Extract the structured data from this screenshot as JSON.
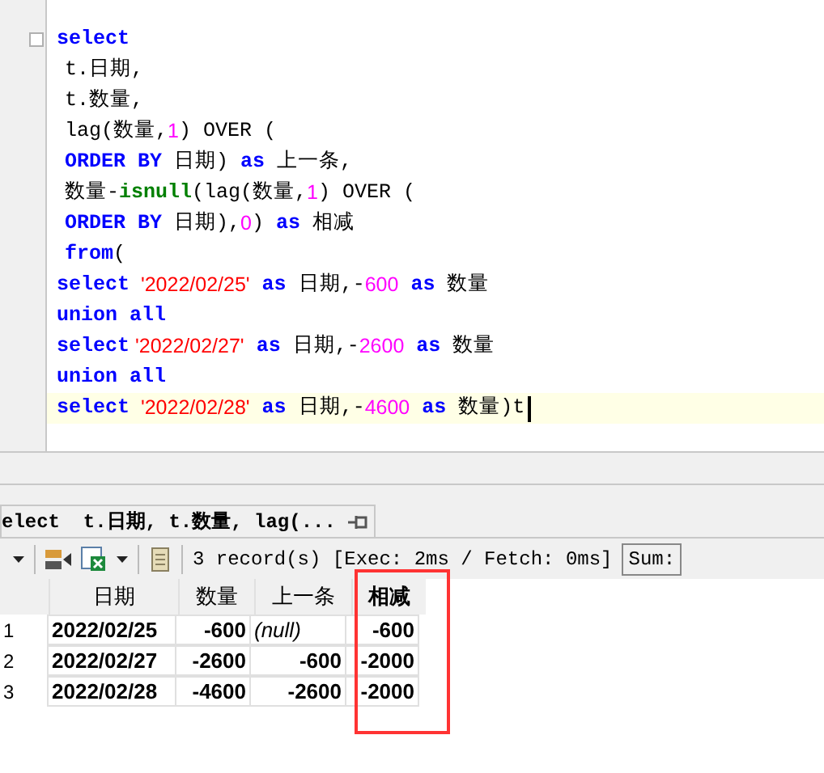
{
  "editor": {
    "lines": [
      {
        "indented": false,
        "current": false,
        "fold": true,
        "tokens": [
          {
            "kind": "keyword",
            "text": "select"
          }
        ]
      },
      {
        "indented": true,
        "current": false,
        "fold": false,
        "tokens": [
          {
            "kind": "plain",
            "text": "t.日期,"
          }
        ]
      },
      {
        "indented": true,
        "current": false,
        "fold": false,
        "tokens": [
          {
            "kind": "plain",
            "text": "t.数量,"
          }
        ]
      },
      {
        "indented": true,
        "current": false,
        "fold": false,
        "tokens": [
          {
            "kind": "plain",
            "text": "lag(数量,"
          },
          {
            "kind": "number",
            "text": "1"
          },
          {
            "kind": "plain",
            "text": ") OVER ("
          }
        ]
      },
      {
        "indented": true,
        "current": false,
        "fold": false,
        "tokens": [
          {
            "kind": "keyword",
            "text": "ORDER BY"
          },
          {
            "kind": "plain",
            "text": " 日期) "
          },
          {
            "kind": "keyword",
            "text": "as"
          },
          {
            "kind": "plain",
            "text": " 上一条,"
          }
        ]
      },
      {
        "indented": true,
        "current": false,
        "fold": false,
        "tokens": [
          {
            "kind": "plain",
            "text": "数量-"
          },
          {
            "kind": "function",
            "text": "isnull"
          },
          {
            "kind": "plain",
            "text": "(lag(数量,"
          },
          {
            "kind": "number",
            "text": "1"
          },
          {
            "kind": "plain",
            "text": ") OVER ("
          }
        ]
      },
      {
        "indented": true,
        "current": false,
        "fold": false,
        "tokens": [
          {
            "kind": "keyword",
            "text": "ORDER BY"
          },
          {
            "kind": "plain",
            "text": " 日期),"
          },
          {
            "kind": "number",
            "text": "0"
          },
          {
            "kind": "plain",
            "text": ") "
          },
          {
            "kind": "keyword",
            "text": "as"
          },
          {
            "kind": "plain",
            "text": " 相减"
          }
        ]
      },
      {
        "indented": true,
        "current": false,
        "fold": false,
        "tokens": [
          {
            "kind": "keyword",
            "text": "from"
          },
          {
            "kind": "plain",
            "text": "("
          }
        ]
      },
      {
        "indented": false,
        "current": false,
        "fold": false,
        "tokens": [
          {
            "kind": "keyword",
            "text": "select"
          },
          {
            "kind": "string",
            "text": "  '2022/02/25'"
          },
          {
            "kind": "keyword",
            "text": " as"
          },
          {
            "kind": "plain",
            "text": " 日期,-"
          },
          {
            "kind": "number",
            "text": "600"
          },
          {
            "kind": "keyword",
            "text": " as"
          },
          {
            "kind": "plain",
            "text": " 数量"
          }
        ]
      },
      {
        "indented": false,
        "current": false,
        "fold": false,
        "tokens": [
          {
            "kind": "keyword",
            "text": "union all"
          }
        ]
      },
      {
        "indented": false,
        "current": false,
        "fold": false,
        "tokens": [
          {
            "kind": "keyword",
            "text": "select"
          },
          {
            "kind": "string",
            "text": " '2022/02/27'"
          },
          {
            "kind": "keyword",
            "text": " as"
          },
          {
            "kind": "plain",
            "text": " 日期,-"
          },
          {
            "kind": "number",
            "text": "2600"
          },
          {
            "kind": "keyword",
            "text": " as"
          },
          {
            "kind": "plain",
            "text": " 数量"
          }
        ]
      },
      {
        "indented": false,
        "current": false,
        "fold": false,
        "tokens": [
          {
            "kind": "keyword",
            "text": "union all"
          }
        ]
      },
      {
        "indented": false,
        "current": true,
        "fold": false,
        "tokens": [
          {
            "kind": "keyword",
            "text": "select"
          },
          {
            "kind": "string",
            "text": "  '2022/02/28'"
          },
          {
            "kind": "keyword",
            "text": " as"
          },
          {
            "kind": "plain",
            "text": " 日期,-"
          },
          {
            "kind": "number",
            "text": "4600"
          },
          {
            "kind": "keyword",
            "text": " as"
          },
          {
            "kind": "plain",
            "text": " 数量)t"
          }
        ]
      }
    ]
  },
  "result_tab": {
    "label": "elect  t.日期, t.数量, lag(..."
  },
  "toolbar": {
    "status": "3 record(s) [Exec: 2ms / Fetch: 0ms]",
    "sum_label": "Sum:"
  },
  "grid": {
    "columns": [
      "日期",
      "数量",
      "上一条",
      "相减"
    ],
    "rows": [
      {
        "number": "1",
        "cells": [
          {
            "text": "2022/02/25",
            "null": false
          },
          {
            "text": "-600",
            "null": false
          },
          {
            "text": "(null)",
            "null": true
          },
          {
            "text": "-600",
            "null": false
          }
        ]
      },
      {
        "number": "2",
        "cells": [
          {
            "text": "2022/02/27",
            "null": false
          },
          {
            "text": "-2600",
            "null": false
          },
          {
            "text": "-600",
            "null": false
          },
          {
            "text": "-2000",
            "null": false
          }
        ]
      },
      {
        "number": "3",
        "cells": [
          {
            "text": "2022/02/28",
            "null": false
          },
          {
            "text": "-4600",
            "null": false
          },
          {
            "text": "-2600",
            "null": false
          },
          {
            "text": "-2000",
            "null": false
          }
        ]
      }
    ]
  }
}
